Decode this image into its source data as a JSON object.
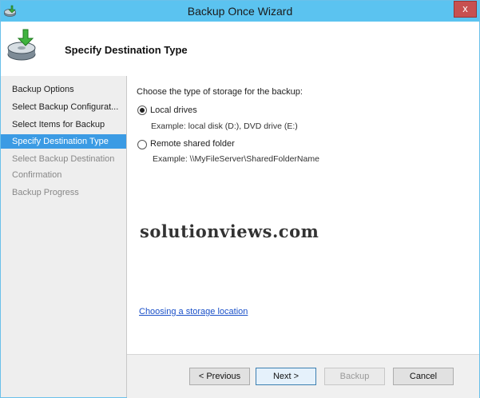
{
  "window": {
    "title": "Backup Once Wizard",
    "close_glyph": "x"
  },
  "header": {
    "title": "Specify Destination Type"
  },
  "nav": {
    "items": [
      {
        "label": "Backup Options",
        "state": "done"
      },
      {
        "label": "Select Backup Configurat...",
        "state": "done"
      },
      {
        "label": "Select Items for Backup",
        "state": "done"
      },
      {
        "label": "Specify Destination Type",
        "state": "active"
      },
      {
        "label": "Select Backup Destination",
        "state": "disabled"
      },
      {
        "label": "Confirmation",
        "state": "disabled"
      },
      {
        "label": "Backup Progress",
        "state": "disabled"
      }
    ]
  },
  "content": {
    "prompt": "Choose the type of storage for the backup:",
    "options": [
      {
        "label": "Local drives",
        "example": "Example: local disk (D:), DVD drive (E:)",
        "checked": true
      },
      {
        "label": "Remote shared folder",
        "example": "Example: \\\\MyFileServer\\SharedFolderName",
        "checked": false
      }
    ],
    "watermark": "solutionviews.com",
    "help_link": "Choosing a storage location"
  },
  "footer": {
    "previous": "< Previous",
    "next": "Next >",
    "backup": "Backup",
    "cancel": "Cancel"
  },
  "colors": {
    "title_bar": "#5bc3f0",
    "selected_nav": "#3b9be4",
    "link": "#1a50c8"
  },
  "icons": {
    "app": "backup-app-icon",
    "header": "disk-backup-icon"
  }
}
